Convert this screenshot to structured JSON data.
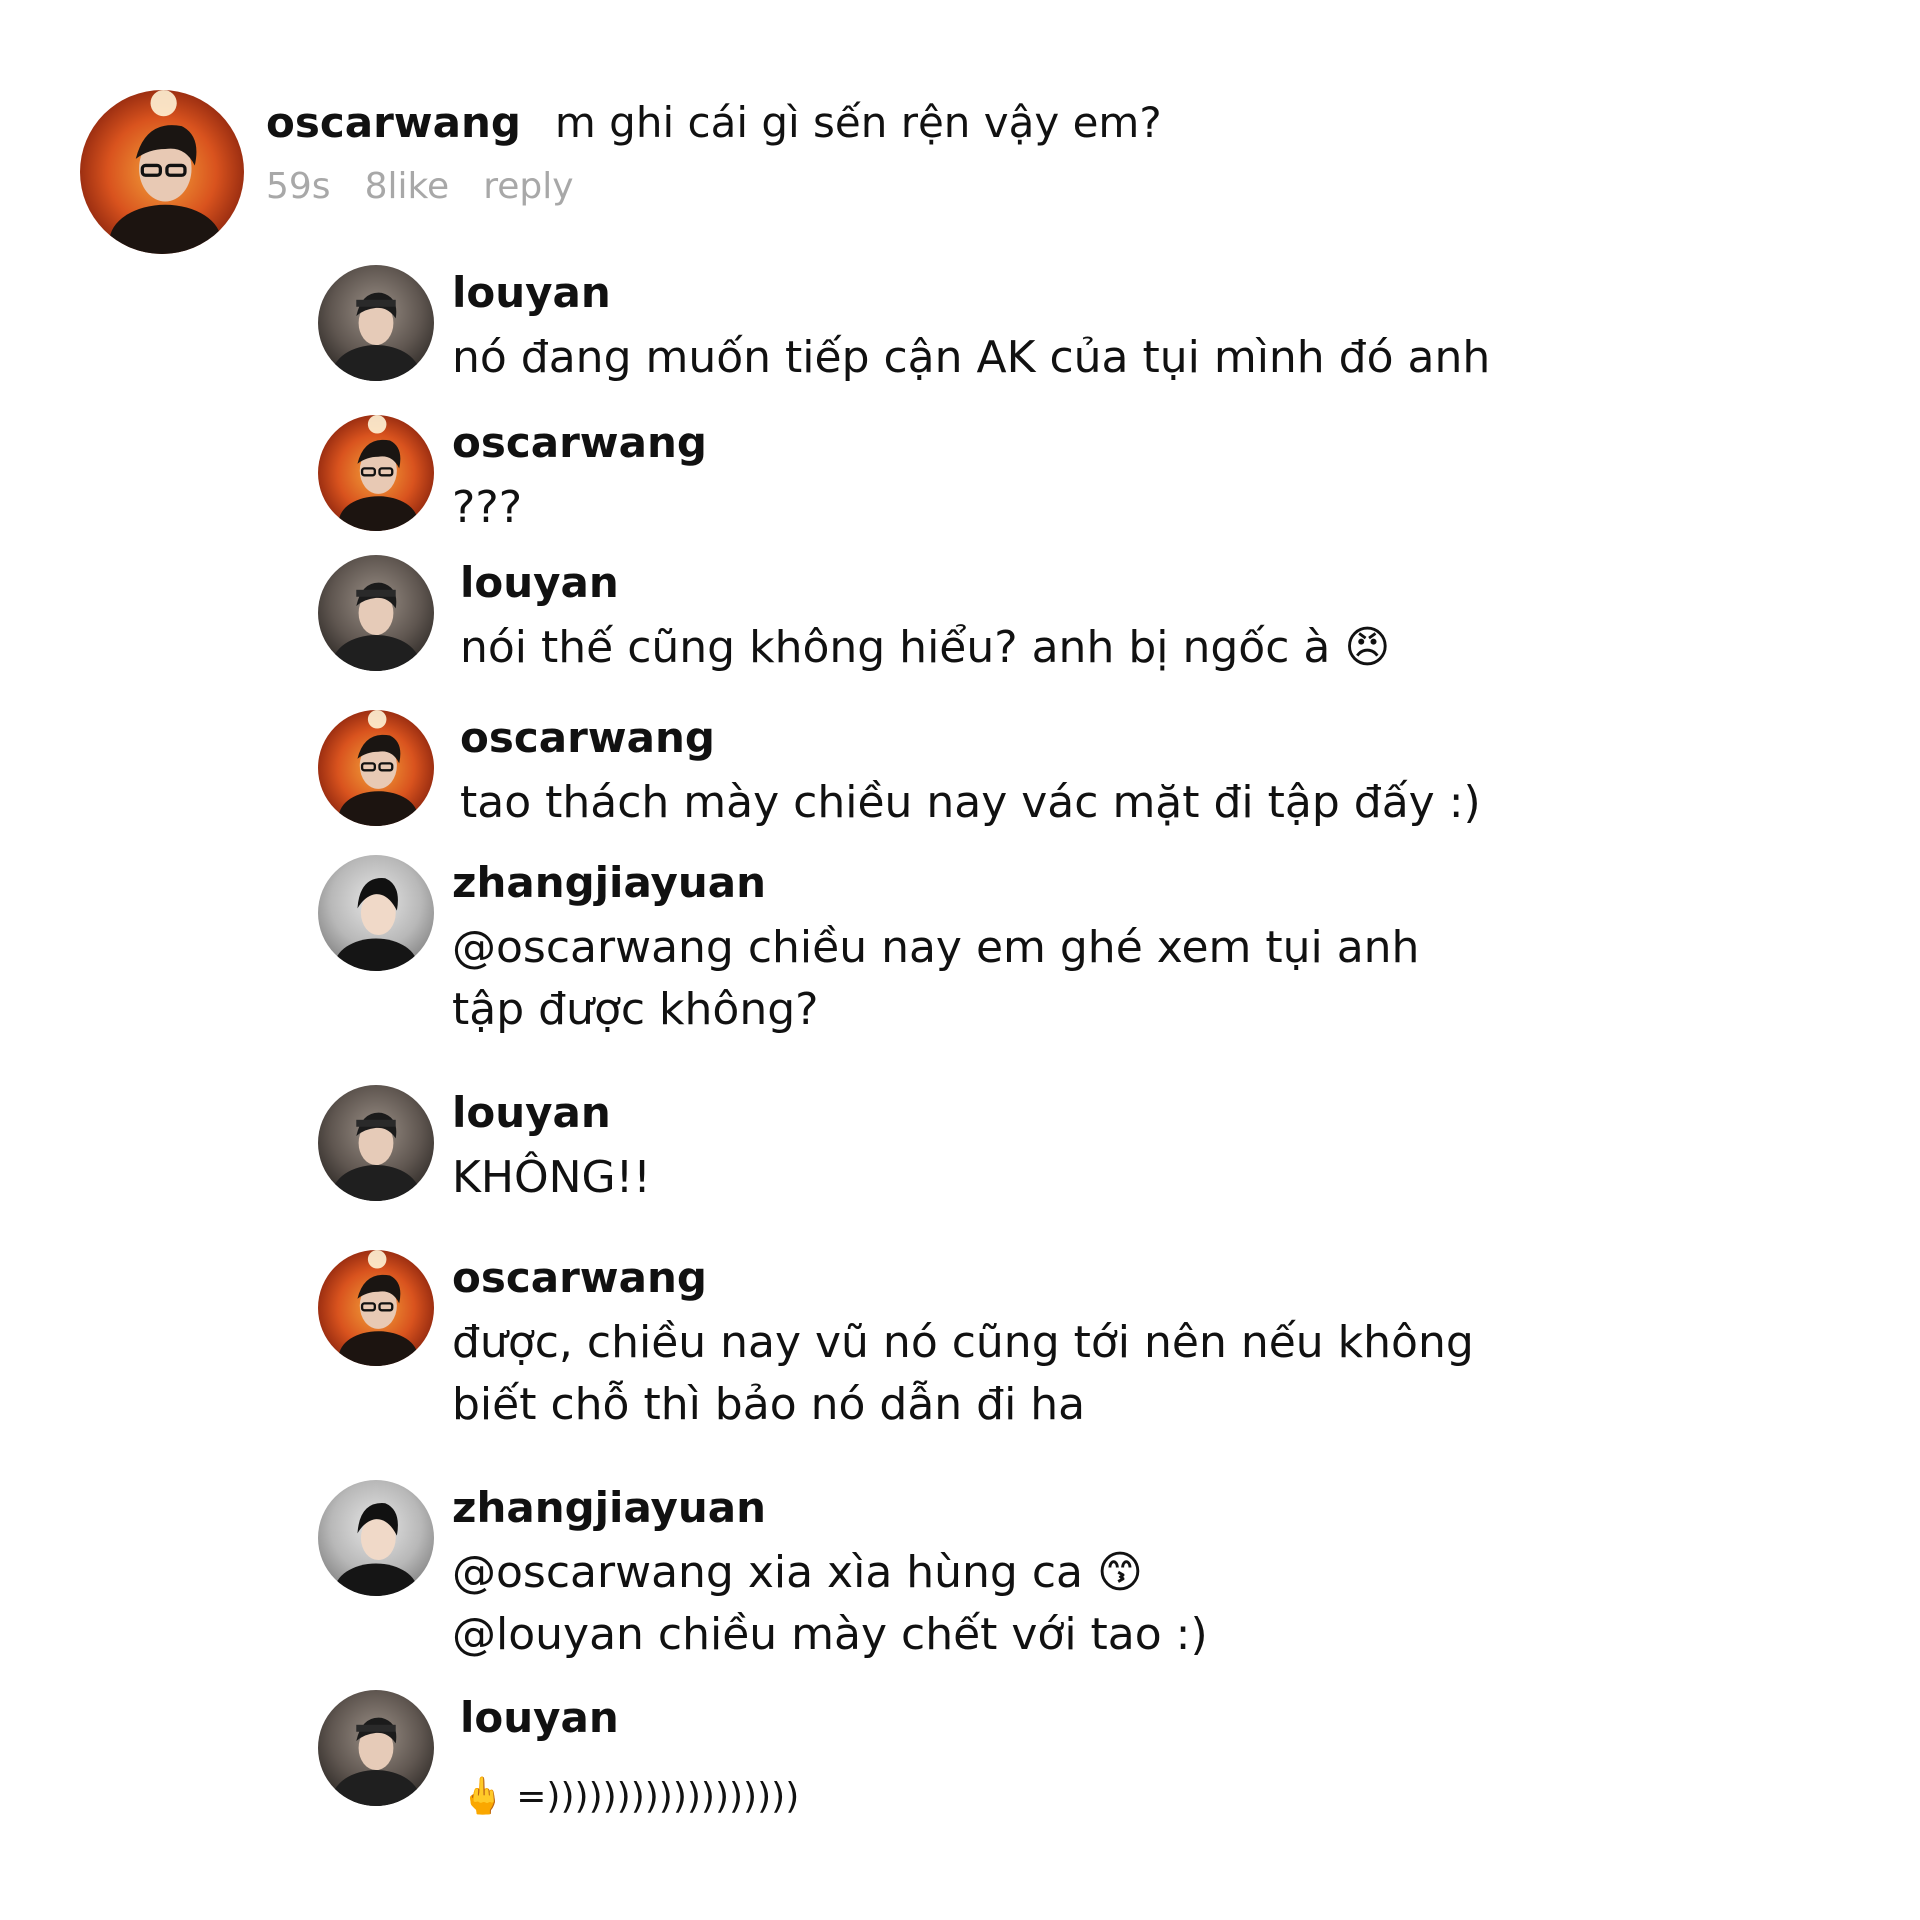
{
  "main_comment": {
    "author": "oscarwang",
    "text": "m ghi cái gì sến rện vậy em?",
    "time": "59s",
    "likes": "8like",
    "reply_label": "reply",
    "avatar_icon": "fire-avatar"
  },
  "replies": [
    {
      "author": "louyan",
      "lines": [
        "nó đang muốn tiếp cận AK của tụi mình đó anh"
      ],
      "avatar_icon": "dark-avatar"
    },
    {
      "author": "oscarwang",
      "lines": [
        "???"
      ],
      "avatar_icon": "fire-avatar"
    },
    {
      "author": "louyan",
      "lines": [
        "nói thế cũng không hiểu? anh bị ngốc à 😠"
      ],
      "avatar_icon": "dark-avatar"
    },
    {
      "author": "oscarwang",
      "lines": [
        "tao thách mày chiều nay vác mặt đi tập đấy :)"
      ],
      "avatar_icon": "fire-avatar"
    },
    {
      "author": "zhangjiayuan",
      "lines": [
        "@oscarwang chiều nay em ghé xem tụi anh",
        "tập được không?"
      ],
      "avatar_icon": "grey-avatar"
    },
    {
      "author": "louyan",
      "lines": [
        "KHÔNG!!"
      ],
      "avatar_icon": "dark-avatar"
    },
    {
      "author": "oscarwang",
      "lines": [
        "được, chiều nay vũ nó cũng tới nên nếu không",
        "biết chỗ thì bảo nó dẫn đi ha"
      ],
      "avatar_icon": "fire-avatar"
    },
    {
      "author": "zhangjiayuan",
      "lines": [
        "@oscarwang xia xìa hùng ca 😙",
        "@louyan chiều mày chết với tao :)"
      ],
      "avatar_icon": "grey-avatar"
    },
    {
      "author": "louyan",
      "lines": [
        "🖕 =))))))))))))))))))"
      ],
      "avatar_icon": "dark-avatar"
    }
  ],
  "colors": {
    "text": "#111111",
    "meta": "#a8a8a8",
    "background": "#ffffff"
  }
}
